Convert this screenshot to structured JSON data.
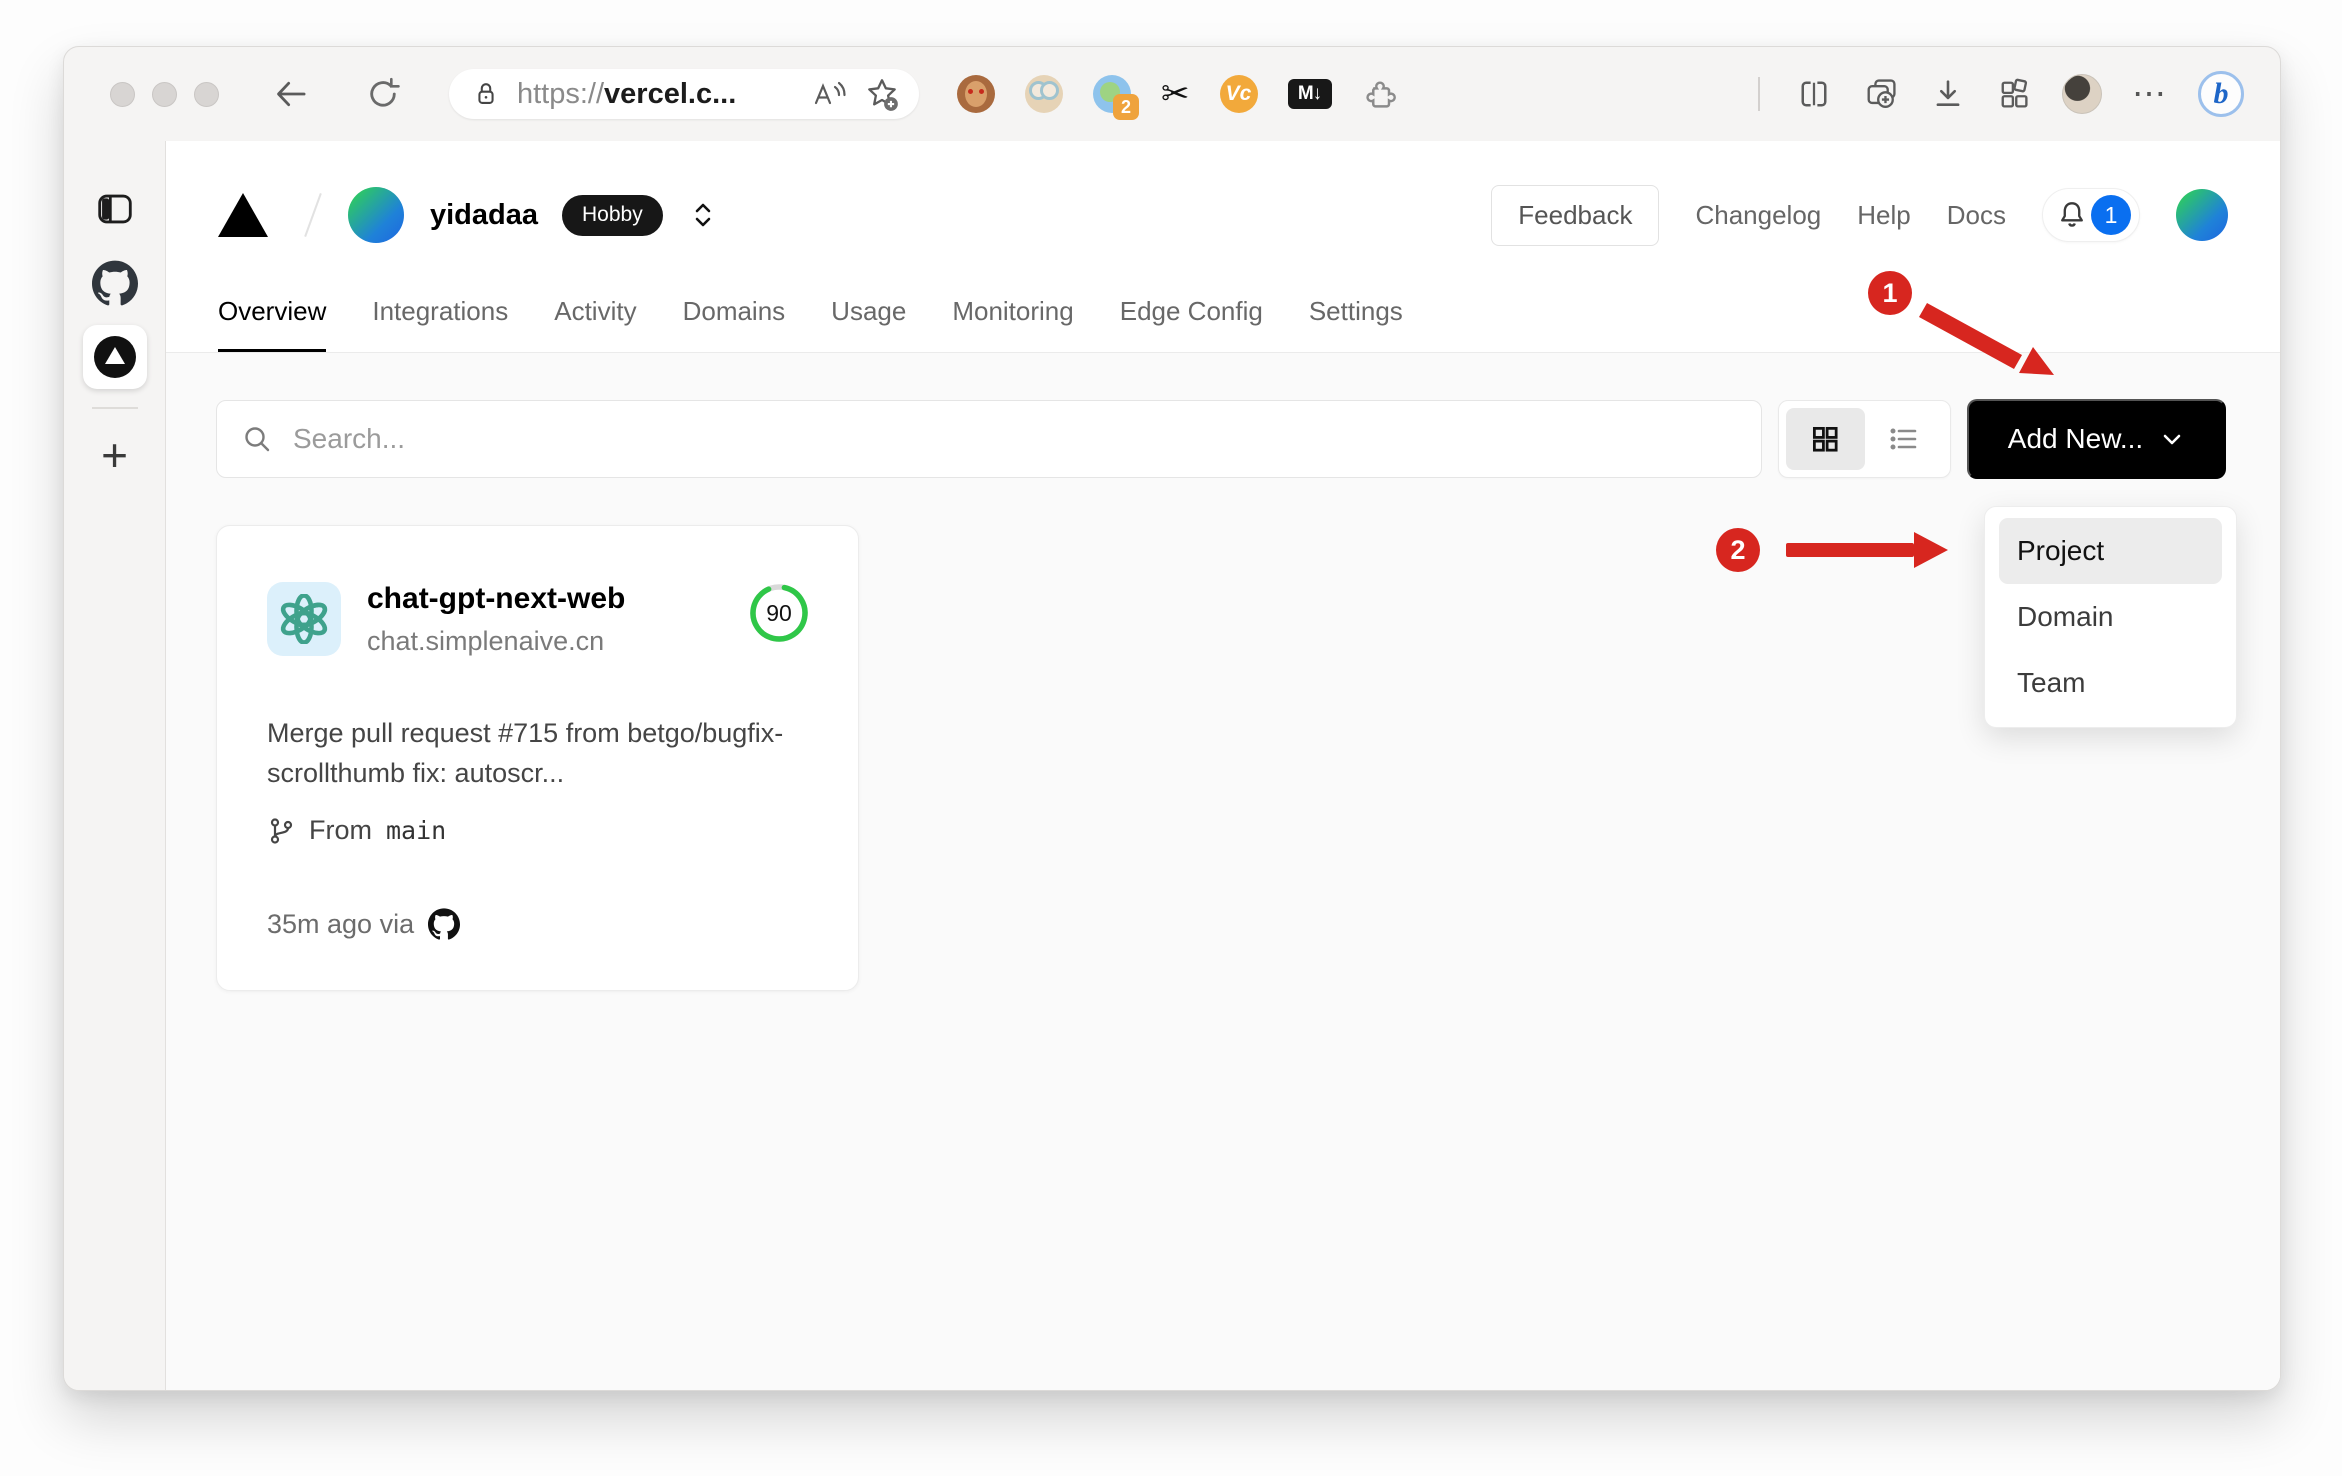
{
  "browser": {
    "url": {
      "scheme": "https://",
      "host": "vercel.c..."
    },
    "translate_badge": "2",
    "icons": {
      "scissors_glyph": "✂",
      "markdown_glyph": "M↓",
      "vc_glyph": "Vc",
      "more_glyph": "⋯",
      "bing_glyph": "b"
    }
  },
  "edge_sidebar": {
    "plus_glyph": "+"
  },
  "header": {
    "team_name": "yidadaa",
    "plan_badge": "Hobby",
    "feedback_label": "Feedback",
    "links": [
      {
        "label": "Changelog"
      },
      {
        "label": "Help"
      },
      {
        "label": "Docs"
      }
    ],
    "notification_count": "1"
  },
  "tabs": [
    {
      "label": "Overview"
    },
    {
      "label": "Integrations"
    },
    {
      "label": "Activity"
    },
    {
      "label": "Domains"
    },
    {
      "label": "Usage"
    },
    {
      "label": "Monitoring"
    },
    {
      "label": "Edge Config"
    },
    {
      "label": "Settings"
    }
  ],
  "toolbar": {
    "search_placeholder": "Search...",
    "add_new_label": "Add New..."
  },
  "dropdown": {
    "items": [
      {
        "label": "Project"
      },
      {
        "label": "Domain"
      },
      {
        "label": "Team"
      }
    ],
    "highlighted": "Project"
  },
  "project_card": {
    "name": "chat-gpt-next-web",
    "domain": "chat.simplenaive.cn",
    "score": "90",
    "commit_message": "Merge pull request #715 from betgo/bugfix-scrollthumb fix: autoscr...",
    "branch_prefix": "From",
    "branch_name": "main",
    "deployed": "35m ago via"
  },
  "annotations": {
    "step1": "1",
    "step2": "2"
  },
  "colors": {
    "accent_red": "#d7261f",
    "badge_blue": "#0a6ff0",
    "score_green": "#2fc748",
    "button_black": "#000000"
  }
}
